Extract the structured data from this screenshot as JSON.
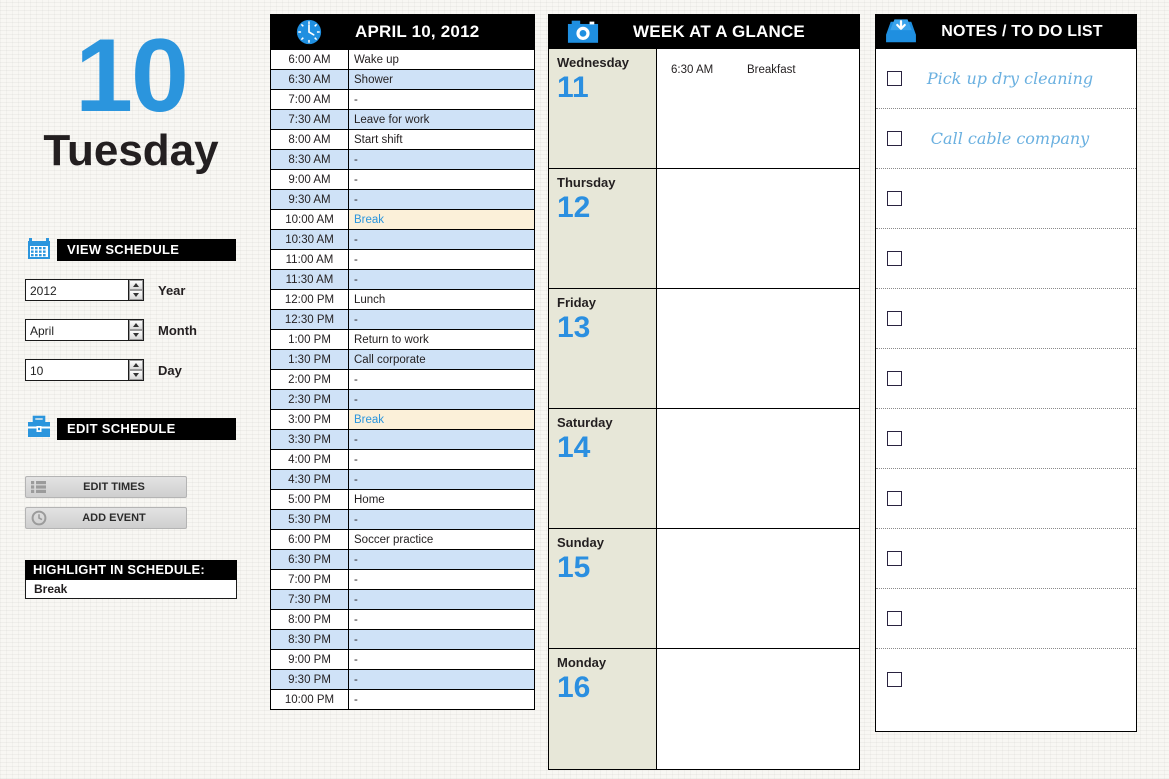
{
  "left": {
    "day_number": "10",
    "weekday": "Tuesday",
    "view_schedule": {
      "label": "VIEW SCHEDULE",
      "icon": "calendar-icon"
    },
    "fields": [
      {
        "value": "2012",
        "label": "Year",
        "name": "year"
      },
      {
        "value": "April",
        "label": "Month",
        "name": "month"
      },
      {
        "value": "10",
        "label": "Day",
        "name": "day"
      }
    ],
    "edit_schedule": {
      "label": "EDIT SCHEDULE",
      "icon": "toolbox-icon"
    },
    "buttons": [
      {
        "label": "EDIT TIMES",
        "icon": "list-icon"
      },
      {
        "label": "ADD EVENT",
        "icon": "clock-icon"
      }
    ],
    "highlight": {
      "title": "HIGHLIGHT IN SCHEDULE:",
      "value": "Break"
    }
  },
  "schedule": {
    "icon": "clock-icon",
    "title": "APRIL 10, 2012",
    "highlight_term": "Break",
    "rows": [
      {
        "time": "6:00 AM",
        "event": "Wake up"
      },
      {
        "time": "6:30 AM",
        "event": "Shower"
      },
      {
        "time": "7:00 AM",
        "event": "-"
      },
      {
        "time": "7:30 AM",
        "event": "Leave for work"
      },
      {
        "time": "8:00 AM",
        "event": "Start shift"
      },
      {
        "time": "8:30 AM",
        "event": "-"
      },
      {
        "time": "9:00 AM",
        "event": "-"
      },
      {
        "time": "9:30 AM",
        "event": "-"
      },
      {
        "time": "10:00 AM",
        "event": "Break"
      },
      {
        "time": "10:30 AM",
        "event": "-"
      },
      {
        "time": "11:00 AM",
        "event": "-"
      },
      {
        "time": "11:30 AM",
        "event": "-"
      },
      {
        "time": "12:00 PM",
        "event": "Lunch"
      },
      {
        "time": "12:30 PM",
        "event": "-"
      },
      {
        "time": "1:00 PM",
        "event": "Return to work"
      },
      {
        "time": "1:30 PM",
        "event": "Call corporate"
      },
      {
        "time": "2:00 PM",
        "event": "-"
      },
      {
        "time": "2:30 PM",
        "event": "-"
      },
      {
        "time": "3:00 PM",
        "event": "Break"
      },
      {
        "time": "3:30 PM",
        "event": "-"
      },
      {
        "time": "4:00 PM",
        "event": "-"
      },
      {
        "time": "4:30 PM",
        "event": "-"
      },
      {
        "time": "5:00 PM",
        "event": "Home"
      },
      {
        "time": "5:30 PM",
        "event": "-"
      },
      {
        "time": "6:00 PM",
        "event": "Soccer practice"
      },
      {
        "time": "6:30 PM",
        "event": "-"
      },
      {
        "time": "7:00 PM",
        "event": "-"
      },
      {
        "time": "7:30 PM",
        "event": "-"
      },
      {
        "time": "8:00 PM",
        "event": "-"
      },
      {
        "time": "8:30 PM",
        "event": "-"
      },
      {
        "time": "9:00 PM",
        "event": "-"
      },
      {
        "time": "9:30 PM",
        "event": "-"
      },
      {
        "time": "10:00 PM",
        "event": "-"
      }
    ]
  },
  "week": {
    "icon": "camera-icon",
    "title": "WEEK AT A GLANCE",
    "days": [
      {
        "name": "Wednesday",
        "number": "11",
        "events": [
          {
            "time": "6:30 AM",
            "desc": "Breakfast"
          }
        ]
      },
      {
        "name": "Thursday",
        "number": "12",
        "events": []
      },
      {
        "name": "Friday",
        "number": "13",
        "events": []
      },
      {
        "name": "Saturday",
        "number": "14",
        "events": []
      },
      {
        "name": "Sunday",
        "number": "15",
        "events": []
      },
      {
        "name": "Monday",
        "number": "16",
        "events": []
      }
    ]
  },
  "notes": {
    "icon": "inbox-download-icon",
    "title": "NOTES / TO DO LIST",
    "items": [
      {
        "text": "Pick up dry cleaning",
        "checked": false
      },
      {
        "text": "Call cable company",
        "checked": false
      },
      {
        "text": "",
        "checked": false
      },
      {
        "text": "",
        "checked": false
      },
      {
        "text": "",
        "checked": false
      },
      {
        "text": "",
        "checked": false
      },
      {
        "text": "",
        "checked": false
      },
      {
        "text": "",
        "checked": false
      },
      {
        "text": "",
        "checked": false
      },
      {
        "text": "",
        "checked": false
      },
      {
        "text": "",
        "checked": false
      }
    ]
  },
  "colors": {
    "accent_blue": "#2b95dd",
    "row_alt_blue": "#cfe2f7",
    "highlight_cream": "#fbf0d9",
    "day_beige": "#e7e7d8",
    "header_black": "#000000",
    "script_blue": "#6ab0e0"
  }
}
